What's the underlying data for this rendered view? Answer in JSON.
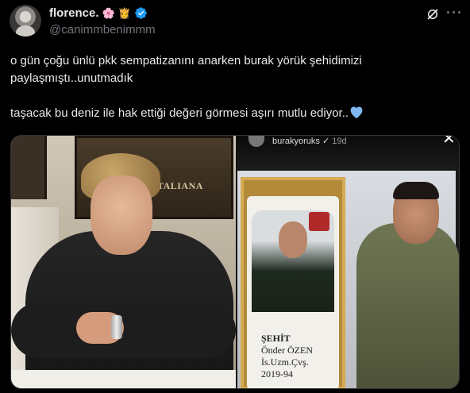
{
  "author": {
    "display_name": "florence.",
    "handle": "@canimmbenimmm",
    "badge_emojis": [
      "🌸",
      "👸"
    ],
    "verified": true
  },
  "tweet": {
    "text": "o gün çoğu ünlü pkk sempatizanını anarken burak yörük şehidimizi paylaşmıştı..unutmadık\n\ntaşacak bu deniz ile hak ettiği değeri görmesi aşırı mutlu ediyor..",
    "trailing_emoji": "blue-heart"
  },
  "media": {
    "left_photo": {
      "wall_sign_text": "GENERALE ITALIANA"
    },
    "right_photo": {
      "story_username": "burakyoruks",
      "story_time": "19d",
      "memorial_lines": [
        "ŞEHİT",
        "Önder ÖZEN",
        "İs.Uzm.Çvş.",
        "2019-94"
      ]
    }
  },
  "icons": {
    "grok": "grok-icon",
    "more": "more-icon",
    "verified": "verified-badge-icon",
    "close": "close-icon"
  },
  "colors": {
    "background": "#000000",
    "text": "#e7e9ea",
    "muted": "#71767b",
    "verified_blue": "#1d9bf0",
    "heart_blue": "#7fb8f0"
  }
}
